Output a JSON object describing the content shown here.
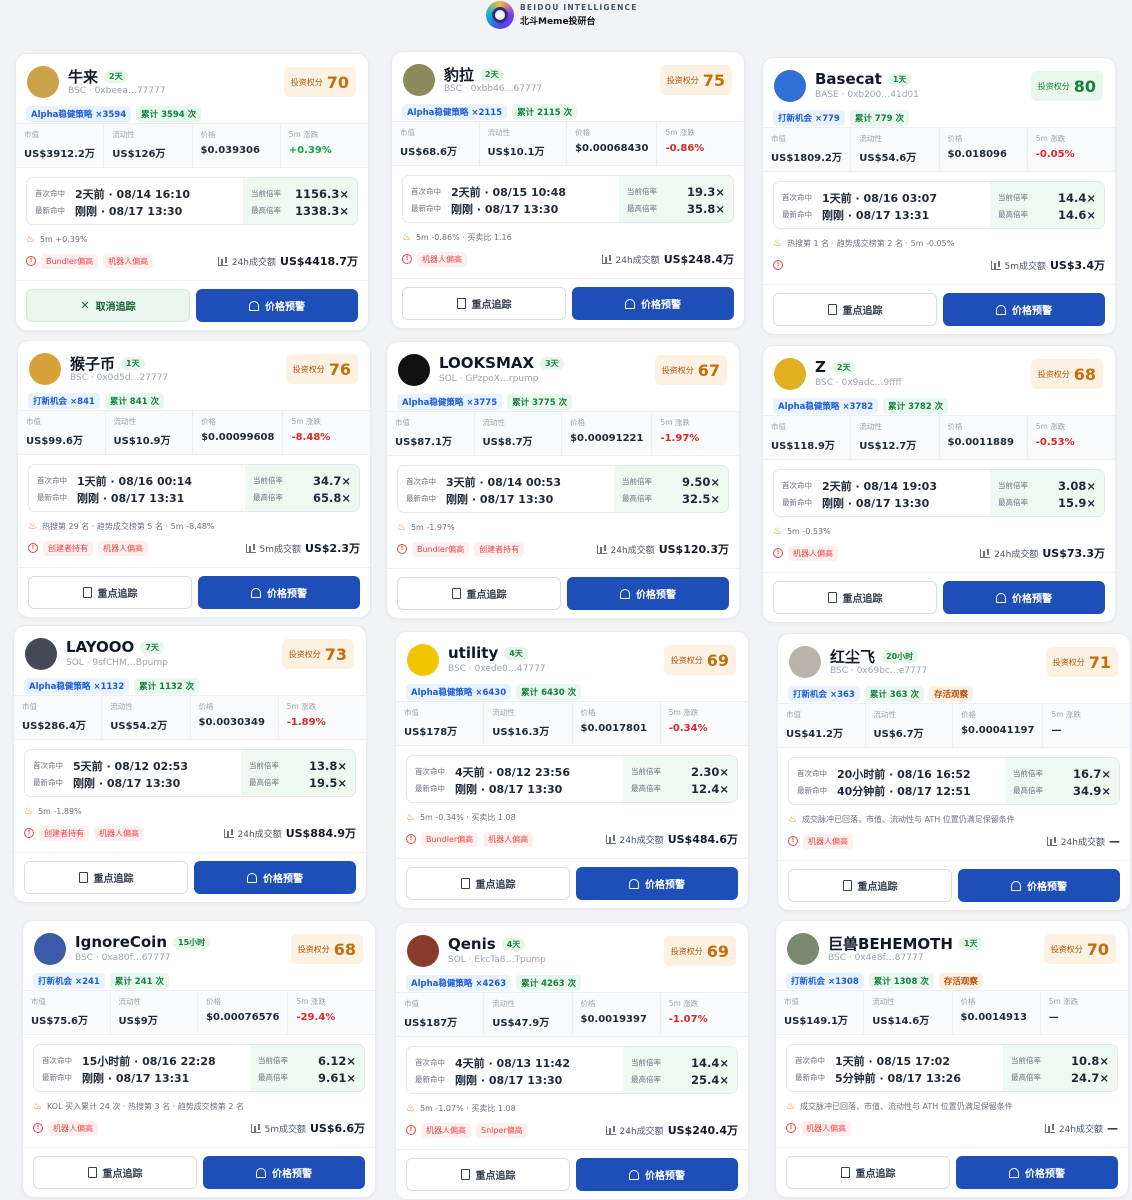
{
  "brand": {
    "en": "BEIDOU INTELLIGENCE",
    "cn": "北斗Meme投研台"
  },
  "labels": {
    "market_cap": "市值",
    "liquidity": "流动性",
    "price": "价格",
    "change_5m": "5m 涨跌",
    "first_hit": "首次命中",
    "latest_hit": "最新命中",
    "current_mult": "当前倍率",
    "max_mult": "最高倍率",
    "score_label": "投资权分",
    "track": "重点追踪",
    "untrack": "取消追踪",
    "alert": "价格预警"
  },
  "cards": [
    {
      "name": "牛来",
      "age": "2天",
      "chain": "BSC · 0xbeea…77777",
      "avatar_color": "#c9a24a",
      "tag1": "Alpha稳健策略 ×3594",
      "tag2": "累计 3594 次",
      "tag3": "",
      "score": "70",
      "mcap": "US$3912.2万",
      "liq": "US$126万",
      "price": "$0.039306",
      "chg": "+0.39%",
      "first": "2天前 · 08/14 16:10",
      "latest": "刚刚 · 08/17 13:30",
      "cur": "1156.3×",
      "max": "1338.3×",
      "signal": "5m +0.39%",
      "risk1": "Bundler偏高",
      "risk2": "机器人偏高",
      "vol_label": "24h成交额",
      "vol": "US$4418.7万",
      "track_label": "取消追踪"
    },
    {
      "name": "豹拉",
      "age": "2天",
      "chain": "BSC · 0xbb46…67777",
      "avatar_color": "#8a8a5a",
      "tag1": "Alpha稳健策略 ×2115",
      "tag2": "累计 2115 次",
      "tag3": "",
      "score": "75",
      "mcap": "US$68.6万",
      "liq": "US$10.1万",
      "price": "$0.00068430",
      "chg": "-0.86%",
      "first": "2天前 · 08/15 10:48",
      "latest": "刚刚 · 08/17 13:30",
      "cur": "19.3×",
      "max": "35.8×",
      "signal": "5m -0.86% · 买卖比 1.16",
      "risk1": "机器人偏高",
      "risk2": "",
      "vol_label": "24h成交额",
      "vol": "US$248.4万",
      "track_label": "重点追踪"
    },
    {
      "name": "Basecat",
      "age": "1天",
      "chain": "BASE · 0xb200…41d01",
      "avatar_color": "#2f6fd6",
      "tag1": "打新机会 ×779",
      "tag2": "累计 779 次",
      "tag3": "",
      "score": "80",
      "mcap": "US$1809.2万",
      "liq": "US$54.6万",
      "price": "$0.018096",
      "chg": "-0.05%",
      "first": "1天前 · 08/16 03:07",
      "latest": "刚刚 · 08/17 13:31",
      "cur": "14.4×",
      "max": "14.6×",
      "signal": "热搜第 1 名 · 趋势成交榜第 2 名 · 5m -0.05%",
      "risk1": "",
      "risk2": "",
      "vol_label": "5m成交额",
      "vol": "US$3.4万",
      "track_label": "重点追踪"
    },
    {
      "name": "猴子币",
      "age": "1天",
      "chain": "BSC · 0x0d5d…27777",
      "avatar_color": "#d8a23a",
      "tag1": "打新机会 ×841",
      "tag2": "累计 841 次",
      "tag3": "",
      "score": "76",
      "mcap": "US$99.6万",
      "liq": "US$10.9万",
      "price": "$0.00099608",
      "chg": "-8.48%",
      "first": "1天前 · 08/16 00:14",
      "latest": "刚刚 · 08/17 13:31",
      "cur": "34.7×",
      "max": "65.8×",
      "signal": "热搜第 29 名 · 趋势成交榜第 5 名 · 5m -8.48%",
      "risk1": "创建者持有",
      "risk2": "机器人偏高",
      "vol_label": "5m成交额",
      "vol": "US$2.3万",
      "track_label": "重点追踪"
    },
    {
      "name": "LOOKSMAX",
      "age": "3天",
      "chain": "SOL · GPzpoX…rpump",
      "avatar_color": "#111111",
      "tag1": "Alpha稳健策略 ×3775",
      "tag2": "累计 3775 次",
      "tag3": "",
      "score": "67",
      "mcap": "US$87.1万",
      "liq": "US$8.7万",
      "price": "$0.00091221",
      "chg": "-1.97%",
      "first": "3天前 · 08/14 00:53",
      "latest": "刚刚 · 08/17 13:30",
      "cur": "9.50×",
      "max": "32.5×",
      "signal": "5m -1.97%",
      "risk1": "Bundler偏高",
      "risk2": "创建者持有",
      "vol_label": "24h成交额",
      "vol": "US$120.3万",
      "track_label": "重点追踪"
    },
    {
      "name": "Z",
      "age": "2天",
      "chain": "BSC · 0x9adc…9ffff",
      "avatar_color": "#e0b020",
      "tag1": "Alpha稳健策略 ×3782",
      "tag2": "累计 3782 次",
      "tag3": "",
      "score": "68",
      "mcap": "US$118.9万",
      "liq": "US$12.7万",
      "price": "$0.0011889",
      "chg": "-0.53%",
      "first": "2天前 · 08/14 19:03",
      "latest": "刚刚 · 08/17 13:30",
      "cur": "3.08×",
      "max": "15.9×",
      "signal": "5m -0.53%",
      "risk1": "机器人偏高",
      "risk2": "",
      "vol_label": "24h成交额",
      "vol": "US$73.3万",
      "track_label": "重点追踪"
    },
    {
      "name": "LAYOOO",
      "age": "7天",
      "chain": "SOL · 9sfCHM…Bpump",
      "avatar_color": "#444a55",
      "tag1": "Alpha稳健策略 ×1132",
      "tag2": "累计 1132 次",
      "tag3": "",
      "score": "73",
      "mcap": "US$286.4万",
      "liq": "US$54.2万",
      "price": "$0.0030349",
      "chg": "-1.89%",
      "first": "5天前 · 08/12 02:53",
      "latest": "刚刚 · 08/17 13:30",
      "cur": "13.8×",
      "max": "19.5×",
      "signal": "5m -1.89%",
      "risk1": "创建者持有",
      "risk2": "机器人偏高",
      "vol_label": "24h成交额",
      "vol": "US$884.9万",
      "track_label": "重点追踪"
    },
    {
      "name": "utility",
      "age": "4天",
      "chain": "BSC · 0xede0…47777",
      "avatar_color": "#f2c400",
      "tag1": "Alpha稳健策略 ×6430",
      "tag2": "累计 6430 次",
      "tag3": "",
      "score": "69",
      "mcap": "US$178万",
      "liq": "US$16.3万",
      "price": "$0.0017801",
      "chg": "-0.34%",
      "first": "4天前 · 08/12 23:56",
      "latest": "刚刚 · 08/17 13:30",
      "cur": "2.30×",
      "max": "12.4×",
      "signal": "5m -0.34% · 买卖比 1.08",
      "risk1": "Bundler偏高",
      "risk2": "机器人偏高",
      "vol_label": "24h成交额",
      "vol": "US$484.6万",
      "track_label": "重点追踪"
    },
    {
      "name": "红尘飞",
      "age": "20小时",
      "chain": "BSC · 0x69bc…e7777",
      "avatar_color": "#b8b4ac",
      "tag1": "打新机会 ×363",
      "tag2": "累计 363 次",
      "tag3": "存活观察",
      "score": "71",
      "mcap": "US$41.2万",
      "liq": "US$6.7万",
      "price": "$0.00041197",
      "chg": "—",
      "first": "20小时前 · 08/16 16:52",
      "latest": "40分钟前 · 08/17 12:51",
      "cur": "16.7×",
      "max": "34.9×",
      "signal": "成交脉冲已回落，市值、流动性与 ATH 位置仍满足保留条件",
      "risk1": "机器人偏高",
      "risk2": "",
      "vol_label": "24h成交额",
      "vol": "—",
      "track_label": "重点追踪"
    },
    {
      "name": "IgnoreCoin",
      "age": "15小时",
      "chain": "BSC · 0xa80f…67777",
      "avatar_color": "#3b5ba9",
      "tag1": "打新机会 ×241",
      "tag2": "累计 241 次",
      "tag3": "",
      "score": "68",
      "mcap": "US$75.6万",
      "liq": "US$9万",
      "price": "$0.00076576",
      "chg": "-29.4%",
      "first": "15小时前 · 08/16 22:28",
      "latest": "刚刚 · 08/17 13:31",
      "cur": "6.12×",
      "max": "9.61×",
      "signal": "KOL 买入累计 24 次 · 热搜第 3 名 · 趋势成交榜第 2 名",
      "risk1": "机器人偏高",
      "risk2": "",
      "vol_label": "5m成交额",
      "vol": "US$6.6万",
      "track_label": "重点追踪"
    },
    {
      "name": "Qenis",
      "age": "4天",
      "chain": "SOL · EkcTa8…Tpump",
      "avatar_color": "#8a3a2a",
      "tag1": "Alpha稳健策略 ×4263",
      "tag2": "累计 4263 次",
      "tag3": "",
      "score": "69",
      "mcap": "US$187万",
      "liq": "US$47.9万",
      "price": "$0.0019397",
      "chg": "-1.07%",
      "first": "4天前 · 08/13 11:42",
      "latest": "刚刚 · 08/17 13:30",
      "cur": "14.4×",
      "max": "25.4×",
      "signal": "5m -1.07% · 买卖比 1.08",
      "risk1": "机器人偏高",
      "risk2": "Sniper偏高",
      "vol_label": "24h成交额",
      "vol": "US$240.4万",
      "track_label": "重点追踪"
    },
    {
      "name": "巨兽BEHEMOTH",
      "age": "1天",
      "chain": "BSC · 0x4e8f…87777",
      "avatar_color": "#7a8a70",
      "tag1": "打新机会 ×1308",
      "tag2": "累计 1308 次",
      "tag3": "存活观察",
      "score": "70",
      "mcap": "US$149.1万",
      "liq": "US$14.6万",
      "price": "$0.0014913",
      "chg": "—",
      "first": "1天前 · 08/15 17:02",
      "latest": "5分钟前 · 08/17 13:26",
      "cur": "10.8×",
      "max": "24.7×",
      "signal": "成交脉冲已回落，市值、流动性与 ATH 位置仍满足保留条件",
      "risk1": "机器人偏高",
      "risk2": "",
      "vol_label": "24h成交额",
      "vol": "—",
      "track_label": "重点追踪"
    }
  ]
}
